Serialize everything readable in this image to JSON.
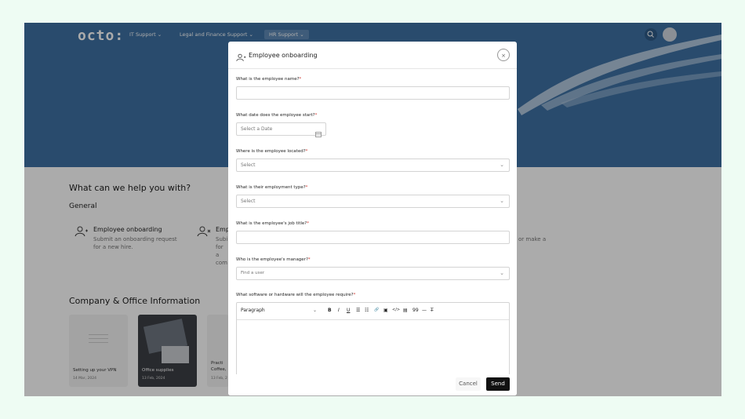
{
  "app": {
    "logo": "octo:",
    "nav": [
      "IT Support",
      "Legal and Finance Support",
      "HR Support"
    ]
  },
  "main": {
    "heading": "What can we help you with?",
    "section": "General",
    "services": [
      {
        "title": "Employee onboarding",
        "desc": "Submit an onboarding request for a new hire."
      },
      {
        "title": "Emp",
        "desc": "Subi for a com"
      }
    ],
    "trailing_text": "or make a",
    "info_heading": "Company & Office Information",
    "cards": [
      {
        "title": "Setting up your VPN",
        "date": "14 Mar, 2024"
      },
      {
        "title": "Office supplies",
        "date": "13 Feb, 2024"
      },
      {
        "title": "Practi Coffee,",
        "date": "13 Feb, 2"
      }
    ]
  },
  "modal": {
    "title": "Employee onboarding",
    "close": "×",
    "fields": [
      {
        "label": "What is the employee name?",
        "value": ""
      },
      {
        "label": "What date does the employee start?",
        "placeholder": "Select a Date"
      },
      {
        "label": "Where is the employee located?",
        "placeholder": "Select"
      },
      {
        "label": "What is their employment type?",
        "placeholder": "Select"
      },
      {
        "label": "What is the employee's job title?",
        "value": ""
      },
      {
        "label": "Who is the employee's manager?",
        "placeholder": "Find a user"
      },
      {
        "label": "What software or hardware will the employee require?"
      }
    ],
    "required_mark": "*",
    "editor": {
      "format": "Paragraph",
      "tools": [
        "B",
        "I",
        "U",
        "☰",
        "☷",
        "🔗",
        "▣",
        "</>",
        "▤",
        "99",
        "—",
        "T̶"
      ]
    },
    "cancel": "Cancel",
    "send": "Send"
  }
}
